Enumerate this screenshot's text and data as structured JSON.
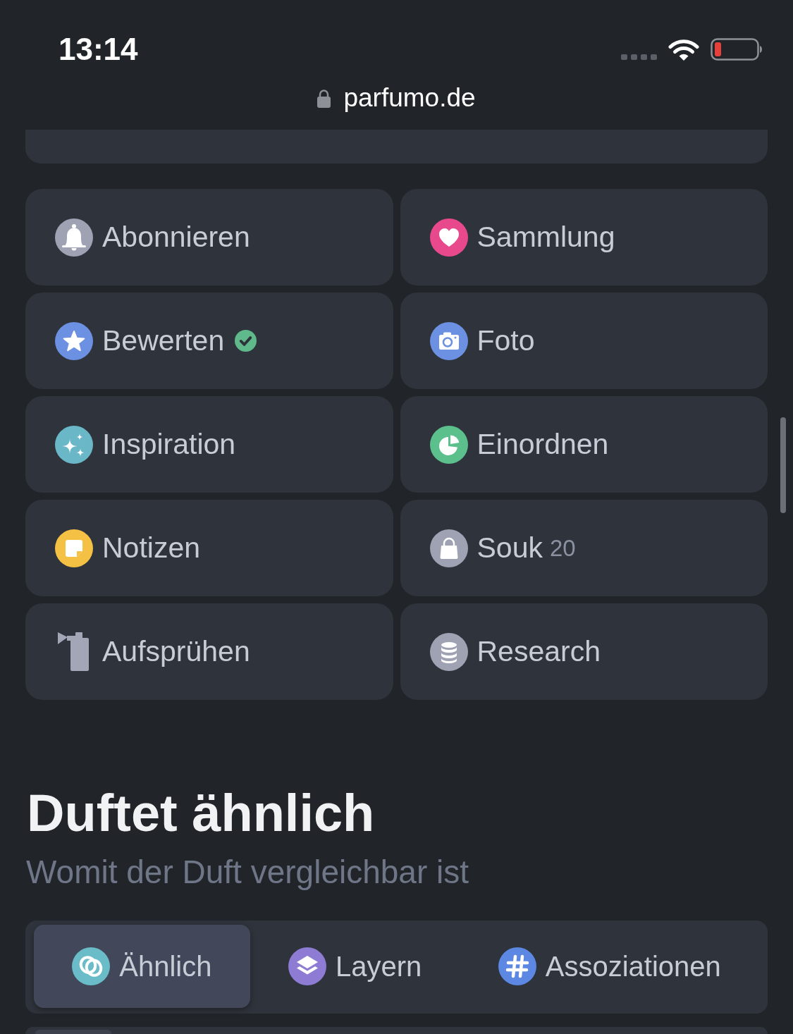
{
  "status_bar": {
    "time": "13:14"
  },
  "address_bar": {
    "url": "parfumo.de"
  },
  "actions": [
    {
      "label": "Abonnieren",
      "checked": false
    },
    {
      "label": "Sammlung",
      "checked": false
    },
    {
      "label": "Bewerten",
      "checked": true
    },
    {
      "label": "Foto",
      "checked": false
    },
    {
      "label": "Inspiration",
      "checked": false
    },
    {
      "label": "Einordnen",
      "checked": false
    },
    {
      "label": "Notizen",
      "checked": false
    },
    {
      "label": "Souk",
      "count": "20",
      "checked": false
    },
    {
      "label": "Aufsprühen",
      "checked": false
    },
    {
      "label": "Research",
      "checked": false
    }
  ],
  "section": {
    "title": "Duftet ähnlich",
    "subtitle": "Womit der Duft vergleichbar ist"
  },
  "tabs": [
    {
      "label": "Ähnlich",
      "selected": true
    },
    {
      "label": "Layern",
      "selected": false
    },
    {
      "label": "Assoziationen",
      "selected": false
    }
  ]
}
